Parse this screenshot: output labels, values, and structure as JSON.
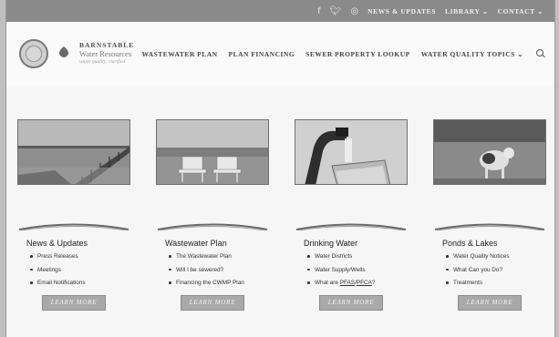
{
  "topbar": {
    "icons": [
      "facebook-icon",
      "twitter-icon",
      "instagram-icon"
    ],
    "links": [
      "NEWS & UPDATES",
      "LIBRARY",
      "CONTACT"
    ]
  },
  "brand": {
    "name": "BARNSTABLE",
    "subtitle": "Water Resources",
    "tagline": "water quality, clarified"
  },
  "nav": {
    "items": [
      "WASTEWATER PLAN",
      "PLAN FINANCING",
      "SEWER PROPERTY LOOKUP",
      "WATER QUALITY TOPICS"
    ]
  },
  "cards": [
    {
      "title": "News & Updates",
      "items": [
        "Press Releases",
        "Meetings",
        "Email Notifications"
      ],
      "button": "LEARN MORE"
    },
    {
      "title": "Wastewater Plan",
      "items": [
        "The Wastewater Plan",
        "Will I be sewered?",
        "Financing the CWMP Plan"
      ],
      "button": "LEARN MORE"
    },
    {
      "title": "Drinking Water",
      "items": [
        "Water Districts",
        "Water Supply/Wells",
        "What are PFAS/PFCA?"
      ],
      "button": "LEARN MORE"
    },
    {
      "title": "Ponds & Lakes",
      "items": [
        "Water Quality Notices",
        "What Can you Do?",
        "Treatments"
      ],
      "button": "LEARN MORE"
    }
  ]
}
